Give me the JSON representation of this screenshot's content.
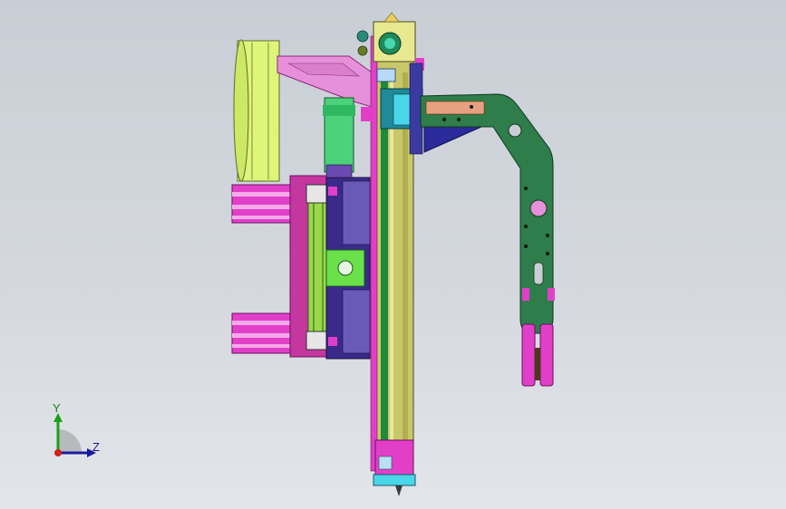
{
  "app": {
    "type": "CAD 3D viewport"
  },
  "triad": {
    "y_label": "Y",
    "z_label": "Z"
  },
  "colors": {
    "background_top": "#c9ced6",
    "background_bottom": "#e2e5e9",
    "lime": "#dff57a",
    "magenta": "#e23fc8",
    "green_arm": "#2e7d4a",
    "olive_rail": "#c8c86a",
    "navy": "#3a2a8a",
    "cyan": "#49d6e8",
    "teal": "#1e8a9a",
    "purple": "#8a3fb0"
  },
  "icons": [
    "coordinate-triad-icon"
  ]
}
